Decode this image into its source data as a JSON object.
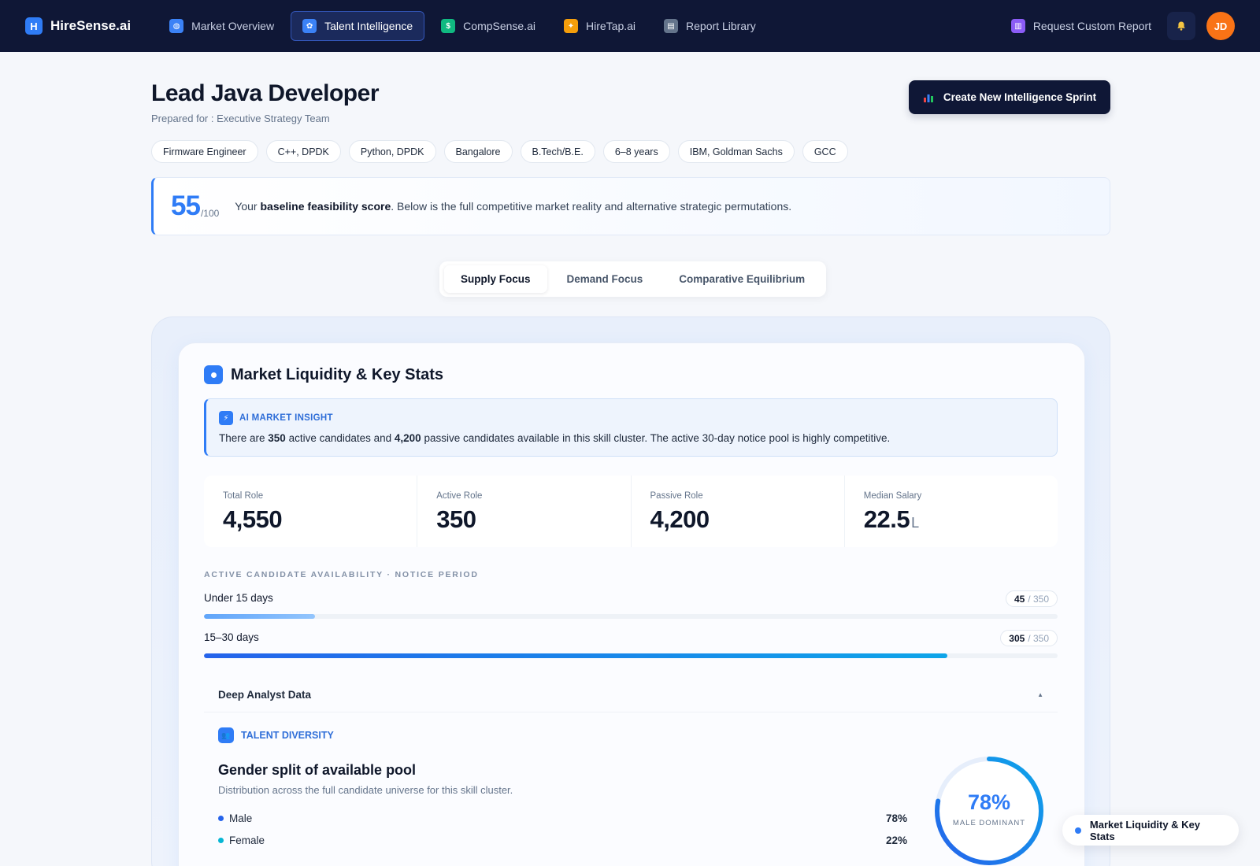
{
  "app": {
    "brand_initial": "H",
    "brand_name": "HireSense.ai"
  },
  "nav": {
    "tabs": [
      {
        "label": "Market Overview",
        "icon": "globe-icon",
        "color": "#3b82f6"
      },
      {
        "label": "Talent Intelligence",
        "icon": "brain-icon",
        "color": "#3b82f6",
        "active": true
      },
      {
        "label": "CompSense.ai",
        "icon": "dollar-icon",
        "color": "#10b981"
      },
      {
        "label": "HireTap.ai",
        "icon": "spark-icon",
        "color": "#f59e0b"
      },
      {
        "label": "Report Library",
        "icon": "archive-icon",
        "color": "#64748b"
      }
    ],
    "request_report": "Request Custom Report",
    "avatar_initials": "JD"
  },
  "header": {
    "title": "Lead Java Developer",
    "subtitle": "Prepared for : Executive Strategy Team",
    "cta": "Create New Intelligence Sprint"
  },
  "chips": [
    "Firmware Engineer",
    "C++, DPDK",
    "Python, DPDK",
    "Bangalore",
    "B.Tech/B.E.",
    "6–8 years",
    "IBM, Goldman Sachs",
    "GCC"
  ],
  "score": {
    "value": "55",
    "out_of": "/100",
    "text_pre": "Your ",
    "text_bold": "baseline feasibility score",
    "text_post": ". Below is the full competitive market reality and alternative strategic permutations."
  },
  "focus_tabs": [
    "Supply Focus",
    "Demand Focus",
    "Comparative Equilibrium"
  ],
  "section": {
    "title": "Market Liquidity & Key Stats",
    "insight_label": "AI MARKET INSIGHT",
    "insight_parts": [
      "There are ",
      "350",
      " active candidates and ",
      "4,200",
      " passive candidates available in this skill cluster. The active 30-day notice pool is highly competitive."
    ]
  },
  "stats": [
    {
      "label": "Total Role",
      "value": "4,550",
      "unit": ""
    },
    {
      "label": "Active Role",
      "value": "350",
      "unit": ""
    },
    {
      "label": "Passive Role",
      "value": "4,200",
      "unit": ""
    },
    {
      "label": "Median Salary",
      "value": "22.5",
      "unit": "L"
    }
  ],
  "availability": {
    "label": "ACTIVE CANDIDATE AVAILABILITY · NOTICE PERIOD",
    "rows": [
      {
        "title": "Under 15 days",
        "count": "45",
        "total": "/ 350",
        "fraction": 0.13
      },
      {
        "title": "15–30 days",
        "count": "305",
        "total": "/ 350",
        "fraction": 0.871
      }
    ]
  },
  "deep": {
    "title": "Deep Analyst Data",
    "diversity_label": "TALENT DIVERSITY",
    "gender_title": "Gender split of available pool",
    "gender_sub": "Distribution across the full candidate universe for this skill cluster.",
    "legend": [
      {
        "label": "Male",
        "value": "78%",
        "color": "#2563eb"
      },
      {
        "label": "Female",
        "value": "22%",
        "color": "#06b6d4"
      }
    ],
    "donut_pct": "78%",
    "donut_caption": "MALE DOMINANT",
    "donut_fraction": 0.78
  },
  "float_pill": "Market Liquidity & Key Stats"
}
